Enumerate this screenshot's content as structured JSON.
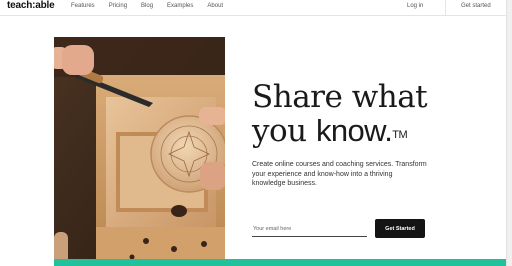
{
  "header": {
    "logo": "teach:able",
    "nav": [
      "Features",
      "Pricing",
      "Blog",
      "Examples",
      "About"
    ],
    "login": "Log in",
    "get_started": "Get started"
  },
  "hero": {
    "headline_line1": "Share what",
    "headline_line2_prefix": "you ",
    "headline_line2_bold": "know.",
    "trademark": "TM",
    "subtext": "Create online courses and coaching services. Transform your experience and know-how into a thriving knowledge business.",
    "email_placeholder": "Your email here",
    "cta_label": "Get Started"
  },
  "colors": {
    "accent_teal": "#1fc29a",
    "cta_bg": "#141414"
  }
}
